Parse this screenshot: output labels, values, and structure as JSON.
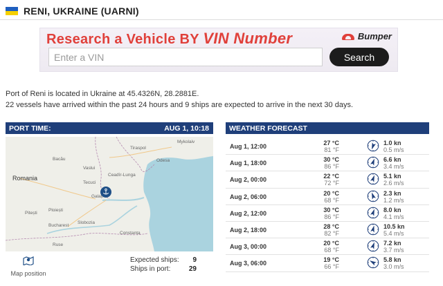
{
  "page": {
    "title": "RENI, UKRAINE (UARNI)",
    "flag_colors": [
      "#1f5fbf",
      "#f5d000"
    ]
  },
  "ad": {
    "headline_prefix": "Research a Vehicle BY ",
    "headline_strong": "VIN Number",
    "brand": "Bumper",
    "input_placeholder": "Enter a VIN",
    "button_label": "Search",
    "accent_color": "#e0403a"
  },
  "intro": {
    "line1": "Port of Reni is located in Ukraine at 45.4326N, 28.2881E.",
    "line2": "22 vessels have arrived within the past 24 hours and 9 ships are expected to arrive in the next 30 days."
  },
  "port_time": {
    "label": "PORT TIME:",
    "value": "AUG 1, 10:18",
    "header_color": "#1f3f7a"
  },
  "map": {
    "places": {
      "romania": "Romania",
      "tiraspol": "Tiraspol",
      "mykolaiv": "Mykolaiv",
      "bacau": "Bacău",
      "odesa": "Odesa",
      "iasi_region": "Vaslui",
      "ceadir": "Ceadîr-Lunga",
      "tecuci": "Tecuci",
      "galati": "Galați",
      "ploiesti": "Ploiești",
      "pitesti": "Pitești",
      "slobozia": "Slobozia",
      "bucharest": "Bucharest",
      "constanta": "Constanța",
      "ruse": "Ruse"
    },
    "map_position_label": "Map position",
    "pin_icon": "anchor-pin-icon"
  },
  "stats": {
    "expected_label": "Expected ships:",
    "expected_value": "9",
    "in_port_label": "Ships in port:",
    "in_port_value": "29"
  },
  "weather": {
    "title": "WEATHER FORECAST",
    "rows": [
      {
        "date": "Aug 1, 12:00",
        "temp_c": "27 °C",
        "temp_f": "81 °F",
        "wind_kn": "1.0 kn",
        "wind_ms": "0.5 m/s",
        "dir_deg": 200
      },
      {
        "date": "Aug 1, 18:00",
        "temp_c": "30 °C",
        "temp_f": "86 °F",
        "wind_kn": "6.6 kn",
        "wind_ms": "3.4 m/s",
        "dir_deg": 20
      },
      {
        "date": "Aug 2, 00:00",
        "temp_c": "22 °C",
        "temp_f": "72 °F",
        "wind_kn": "5.1 kn",
        "wind_ms": "2.6 m/s",
        "dir_deg": 20
      },
      {
        "date": "Aug 2, 06:00",
        "temp_c": "20 °C",
        "temp_f": "68 °F",
        "wind_kn": "2.3 kn",
        "wind_ms": "1.2 m/s",
        "dir_deg": 340
      },
      {
        "date": "Aug 2, 12:00",
        "temp_c": "30 °C",
        "temp_f": "86 °F",
        "wind_kn": "8.0 kn",
        "wind_ms": "4.1 m/s",
        "dir_deg": 20
      },
      {
        "date": "Aug 2, 18:00",
        "temp_c": "28 °C",
        "temp_f": "82 °F",
        "wind_kn": "10.5 kn",
        "wind_ms": "5.4 m/s",
        "dir_deg": 15
      },
      {
        "date": "Aug 3, 00:00",
        "temp_c": "20 °C",
        "temp_f": "68 °F",
        "wind_kn": "7.2 kn",
        "wind_ms": "3.7 m/s",
        "dir_deg": 20
      },
      {
        "date": "Aug 3, 06:00",
        "temp_c": "19 °C",
        "temp_f": "66 °F",
        "wind_kn": "5.8 kn",
        "wind_ms": "3.0 m/s",
        "dir_deg": 300
      }
    ]
  }
}
